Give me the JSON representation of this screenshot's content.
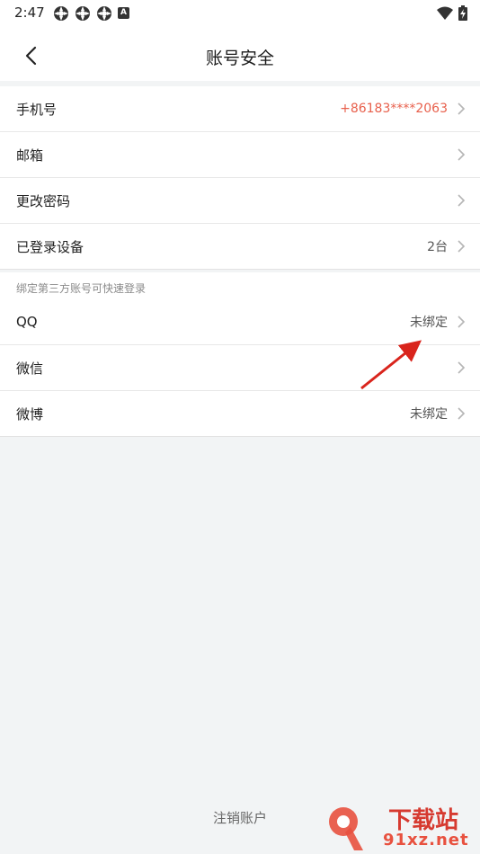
{
  "status_bar": {
    "time": "2:47",
    "notification_badge": "A"
  },
  "header": {
    "title": "账号安全"
  },
  "account_rows": [
    {
      "label": "手机号",
      "value": "+86183****2063"
    },
    {
      "label": "邮箱",
      "value": ""
    },
    {
      "label": "更改密码",
      "value": ""
    },
    {
      "label": "已登录设备",
      "value": "2台"
    }
  ],
  "third_party": {
    "hint": "绑定第三方账号可快速登录",
    "rows": [
      {
        "label": "QQ",
        "value": "未绑定"
      },
      {
        "label": "微信",
        "value": ""
      },
      {
        "label": "微博",
        "value": "未绑定"
      }
    ]
  },
  "footer": {
    "deactivate_label": "注销账户"
  },
  "watermark": {
    "logo_text": "下载站",
    "site_text": "91xz.net"
  },
  "colors": {
    "accent_red": "#e8604c",
    "background": "#f2f4f5"
  }
}
